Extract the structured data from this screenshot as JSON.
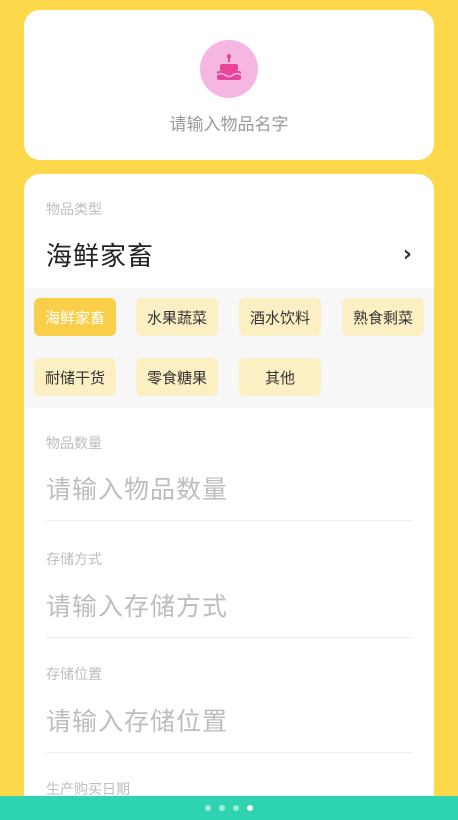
{
  "item_header": {
    "avatar_icon": "cake-icon",
    "name_placeholder": "请输入物品名字"
  },
  "category": {
    "label": "物品类型",
    "value": "海鲜家畜",
    "chevron": "›",
    "chips": [
      "海鲜家畜",
      "水果蔬菜",
      "酒水饮料",
      "熟食剩菜",
      "耐储干货",
      "零食糖果",
      "其他"
    ],
    "selected_index": 0
  },
  "fields": [
    {
      "label": "物品数量",
      "placeholder": "请输入物品数量"
    },
    {
      "label": "存储方式",
      "placeholder": "请输入存储方式"
    },
    {
      "label": "存储位置",
      "placeholder": "请输入存储位置"
    },
    {
      "label": "生产购买日期"
    }
  ],
  "pager": {
    "total": 4,
    "active": 3
  },
  "colors": {
    "background": "#FDD84A",
    "chip": "#FCEFC3",
    "chip_selected": "#F9CF4A",
    "bottom_bar": "#2ED3B2",
    "avatar": "#F6B6E2"
  }
}
